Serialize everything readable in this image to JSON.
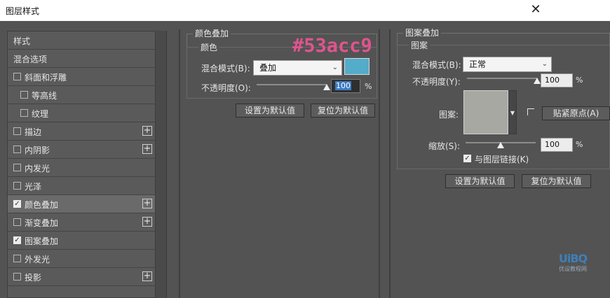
{
  "window": {
    "title": "图层样式",
    "close_glyph": "✕"
  },
  "sidebar": {
    "items": [
      {
        "label": "样式",
        "checkbox": false,
        "checked": false,
        "plus": false,
        "indent": 0
      },
      {
        "label": "混合选项",
        "checkbox": false,
        "checked": false,
        "plus": false,
        "indent": 0
      },
      {
        "label": "斜面和浮雕",
        "checkbox": true,
        "checked": false,
        "plus": false,
        "indent": 0
      },
      {
        "label": "等高线",
        "checkbox": true,
        "checked": false,
        "plus": false,
        "indent": 1
      },
      {
        "label": "纹理",
        "checkbox": true,
        "checked": false,
        "plus": false,
        "indent": 1
      },
      {
        "label": "描边",
        "checkbox": true,
        "checked": false,
        "plus": true,
        "indent": 0
      },
      {
        "label": "内阴影",
        "checkbox": true,
        "checked": false,
        "plus": true,
        "indent": 0
      },
      {
        "label": "内发光",
        "checkbox": true,
        "checked": false,
        "plus": false,
        "indent": 0
      },
      {
        "label": "光泽",
        "checkbox": true,
        "checked": false,
        "plus": false,
        "indent": 0
      },
      {
        "label": "颜色叠加",
        "checkbox": true,
        "checked": true,
        "plus": true,
        "indent": 0,
        "active": true
      },
      {
        "label": "渐变叠加",
        "checkbox": true,
        "checked": false,
        "plus": true,
        "indent": 0
      },
      {
        "label": "图案叠加",
        "checkbox": true,
        "checked": true,
        "plus": false,
        "indent": 0
      },
      {
        "label": "外发光",
        "checkbox": true,
        "checked": false,
        "plus": false,
        "indent": 0
      },
      {
        "label": "投影",
        "checkbox": true,
        "checked": false,
        "plus": true,
        "indent": 0
      }
    ]
  },
  "color_overlay": {
    "section_title": "颜色叠加",
    "group_title": "颜色",
    "blend_label": "混合模式(B):",
    "blend_value": "叠加",
    "color_hex_label": "#53acc9",
    "color": "#53acc9",
    "opacity_label": "不透明度(O):",
    "opacity_value": "100",
    "opacity_level": 1.0,
    "percent": "%",
    "set_default": "设置为默认值",
    "reset_default": "复位为默认值"
  },
  "pattern_overlay": {
    "section_title": "图案叠加",
    "group_title": "图案",
    "blend_label": "混合模式(B):",
    "blend_value": "正常",
    "opacity_label": "不透明度(Y):",
    "opacity_value": "100",
    "opacity_level": 1.0,
    "pattern_label": "图案:",
    "snap_origin": "贴紧原点(A)",
    "scale_label": "缩放(S):",
    "scale_value": "100",
    "percent": "%",
    "link_label": "与图层链接(K)",
    "link_checked": true,
    "set_default": "设置为默认值",
    "reset_default": "复位为默认值"
  },
  "watermark": {
    "big": "UiBQ",
    "small": "优设教程网"
  },
  "icons": {
    "plus": "plus-icon",
    "check": "check-icon",
    "dropdown": "chevron-down-icon",
    "close": "close-icon"
  }
}
